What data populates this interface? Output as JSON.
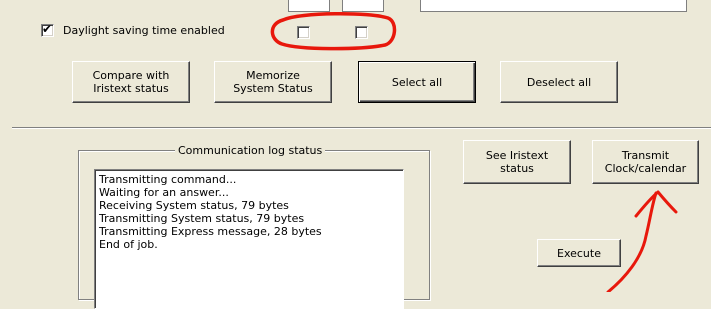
{
  "settings": {
    "dst_label": "Daylight saving time enabled",
    "dst_checked": true
  },
  "buttons": {
    "compare": "Compare with\nIristext status",
    "memorize": "Memorize\nSystem Status",
    "select_all": "Select all",
    "deselect_all": "Deselect all",
    "see_iristext": "See Iristext\nstatus",
    "transmit": "Transmit\nClock/calendar",
    "execute": "Execute"
  },
  "log": {
    "title": "Communication log status",
    "lines": [
      "Transmitting command...",
      "Waiting for an answer...",
      "Receiving System status, 79 bytes",
      "Transmitting System status, 79 bytes",
      "Transmitting Express message, 28 bytes",
      "End of job."
    ]
  },
  "annotation_color": "#e8180c"
}
